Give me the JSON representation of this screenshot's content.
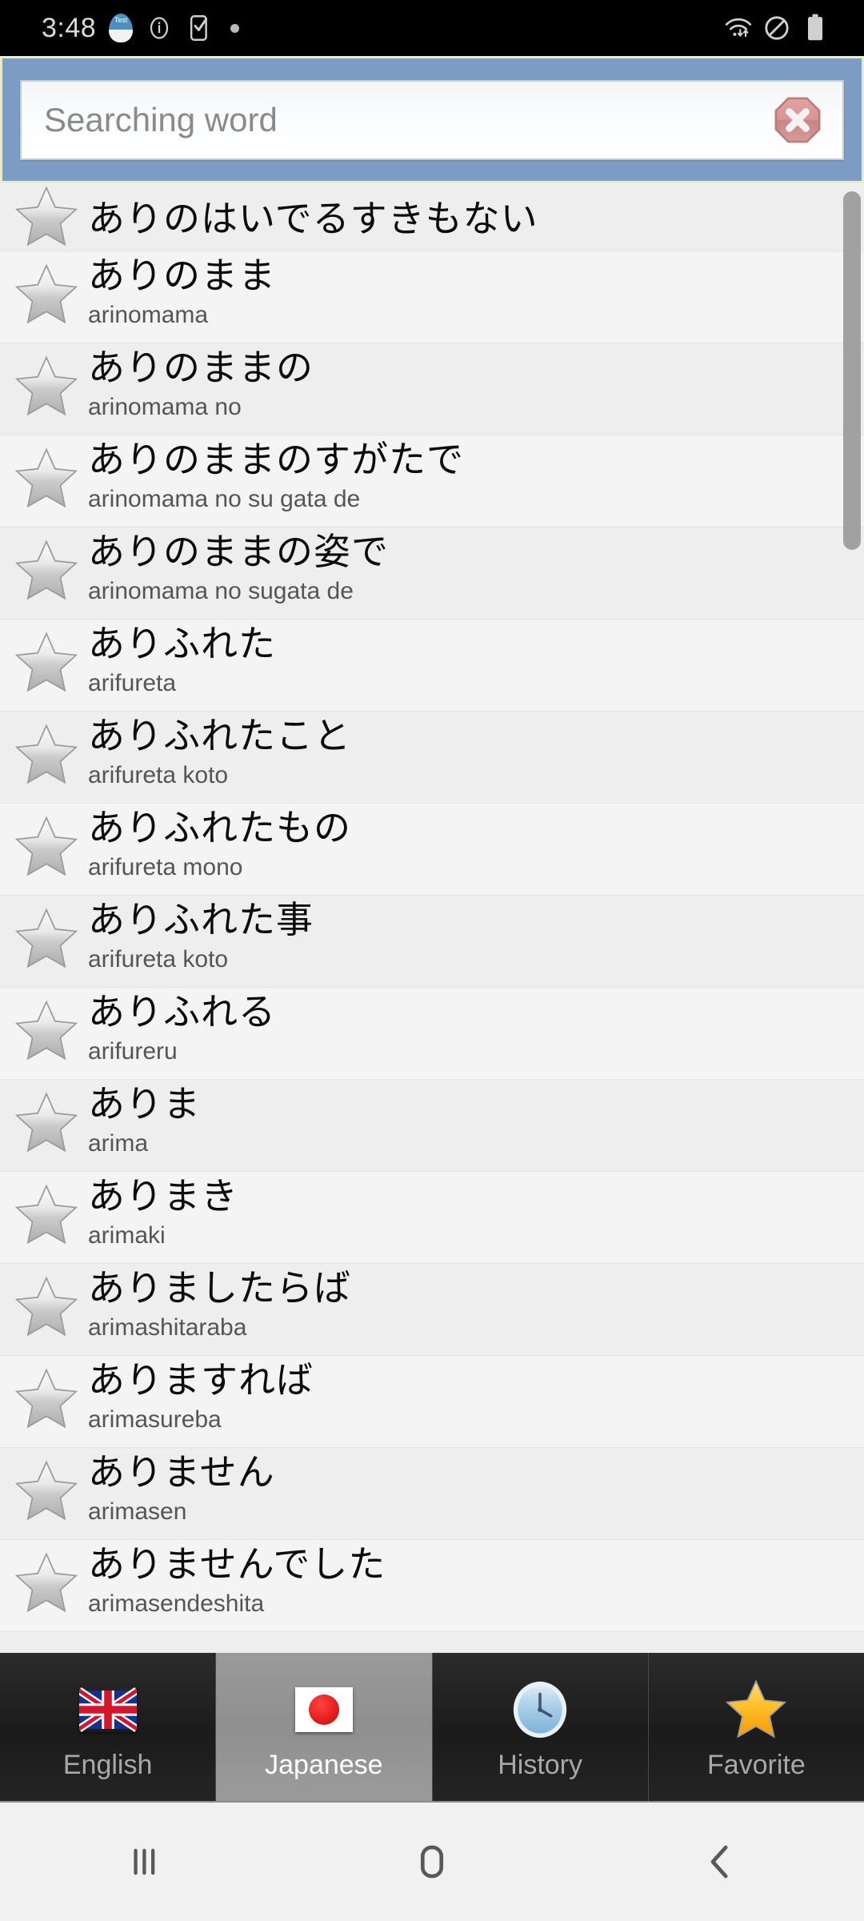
{
  "status_bar": {
    "time": "3:48",
    "left_icons": [
      "test-app-icon",
      "info-circle-icon",
      "phone-check-icon",
      "dot-icon"
    ],
    "right_icons": [
      "wifi-transfer-icon",
      "do-not-disturb-icon",
      "battery-icon"
    ]
  },
  "search": {
    "value": "",
    "placeholder": "Searching word",
    "clear_icon": "clear-octagon-icon",
    "bar_color": "#7d9cc4",
    "border_color": "#e8eccd"
  },
  "list": {
    "scrollbar_visible": true,
    "items": [
      {
        "jp": "ありのはいでるすきもない",
        "romaji": ""
      },
      {
        "jp": "ありのまま",
        "romaji": "arinomama"
      },
      {
        "jp": "ありのままの",
        "romaji": "arinomama no"
      },
      {
        "jp": "ありのままのすがたで",
        "romaji": "arinomama no su gata de"
      },
      {
        "jp": "ありのままの姿で",
        "romaji": "arinomama no sugata de"
      },
      {
        "jp": "ありふれた",
        "romaji": "arifureta"
      },
      {
        "jp": "ありふれたこと",
        "romaji": "arifureta koto"
      },
      {
        "jp": "ありふれたもの",
        "romaji": "arifureta mono"
      },
      {
        "jp": "ありふれた事",
        "romaji": "arifureta koto"
      },
      {
        "jp": "ありふれる",
        "romaji": "arifureru"
      },
      {
        "jp": "ありま",
        "romaji": "arima"
      },
      {
        "jp": "ありまき",
        "romaji": "arimaki"
      },
      {
        "jp": "ありましたらば",
        "romaji": "arimashitaraba"
      },
      {
        "jp": "ありますれば",
        "romaji": "arimasureba"
      },
      {
        "jp": "ありません",
        "romaji": "arimasen"
      },
      {
        "jp": "ありませんでした",
        "romaji": "arimasendeshita"
      }
    ]
  },
  "tabs": [
    {
      "label": "English",
      "icon": "uk-flag-icon",
      "active": false
    },
    {
      "label": "Japanese",
      "icon": "japan-flag-icon",
      "active": true
    },
    {
      "label": "History",
      "icon": "clock-icon",
      "active": false
    },
    {
      "label": "Favorite",
      "icon": "gold-star-icon",
      "active": false
    }
  ],
  "nav_bar": {
    "recents_icon": "recent-apps-icon",
    "home_icon": "home-icon",
    "back_icon": "back-icon"
  }
}
